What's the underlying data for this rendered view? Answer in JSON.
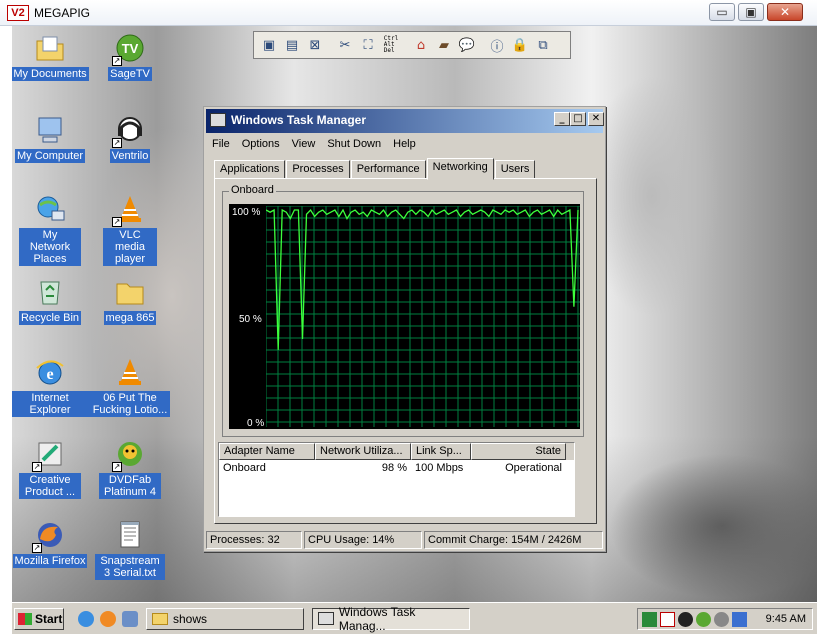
{
  "vnc": {
    "logo": "V2",
    "title": "MEGAPIG",
    "controls": [
      "▭",
      "▣",
      "✕"
    ],
    "toolbar_icons": [
      "new-connection-icon",
      "save-icon",
      "disconnect-icon",
      "options-icon",
      "fullscreen-icon",
      "ctrl-alt-del-icon",
      "transfer-icon",
      "folder-icon",
      "chat-icon",
      "info-icon",
      "lock-icon",
      "windows-icon"
    ],
    "ctrl_alt_del_text": "Ctrl\nAlt\nDel"
  },
  "desktop": {
    "icons_left": [
      {
        "name": "My Documents",
        "icon": "folder-docs-icon"
      },
      {
        "name": "My Computer",
        "icon": "computer-icon"
      },
      {
        "name": "My Network Places",
        "icon": "network-icon"
      },
      {
        "name": "Recycle Bin",
        "icon": "recycle-bin-icon"
      },
      {
        "name": "Internet Explorer",
        "icon": "ie-icon"
      },
      {
        "name": "Creative Product ...",
        "icon": "creative-icon"
      },
      {
        "name": "Mozilla Firefox",
        "icon": "firefox-icon"
      }
    ],
    "icons_right": [
      {
        "name": "SageTV",
        "icon": "sagetv-icon"
      },
      {
        "name": "Ventrilo",
        "icon": "ventrilo-icon"
      },
      {
        "name": "VLC media player",
        "icon": "vlc-icon"
      },
      {
        "name": "mega 865",
        "icon": "folder-icon"
      },
      {
        "name": "06 Put The Fucking Lotio...",
        "icon": "vlc-icon"
      },
      {
        "name": "DVDFab Platinum 4",
        "icon": "dvdfab-icon"
      },
      {
        "name": "Snapstream 3 Serial.txt",
        "icon": "text-file-icon"
      }
    ]
  },
  "task_manager": {
    "title": "Windows Task Manager",
    "menu": [
      "File",
      "Options",
      "View",
      "Shut Down",
      "Help"
    ],
    "tabs": [
      "Applications",
      "Processes",
      "Performance",
      "Networking",
      "Users"
    ],
    "active_tab": "Networking",
    "graph": {
      "title": "Onboard",
      "y_labels": [
        "100 %",
        "50 %",
        "0 %"
      ]
    },
    "adapters": {
      "columns": [
        "Adapter Name",
        "Network Utiliza...",
        "Link Sp...",
        "State"
      ],
      "rows": [
        {
          "name": "Onboard",
          "util": "98 %",
          "speed": "100 Mbps",
          "state": "Operational"
        }
      ]
    },
    "status": {
      "processes": "Processes: 32",
      "cpu": "CPU Usage: 14%",
      "commit": "Commit Charge: 154M / 2426M"
    }
  },
  "chart_data": {
    "type": "line",
    "title": "Onboard",
    "ylim": [
      0,
      100
    ],
    "yticks": [
      "100 %",
      "50 %",
      "0 %"
    ],
    "grid": true,
    "series": [
      {
        "values": [
          100,
          99,
          100,
          35,
          100,
          99,
          96,
          100,
          100,
          40,
          98,
          100,
          97,
          99,
          100,
          98,
          99,
          100,
          97,
          100,
          96,
          99,
          100,
          98,
          99,
          97,
          100,
          99,
          98,
          100,
          97,
          99,
          100,
          98,
          96,
          99,
          100,
          98,
          100,
          99,
          97,
          100,
          98,
          99,
          100,
          98,
          99,
          100,
          97,
          99,
          100,
          98,
          99,
          100,
          99,
          97,
          100,
          99,
          98,
          100,
          99,
          100,
          98,
          99,
          100,
          97,
          99,
          100,
          98,
          99,
          100,
          97,
          100,
          98,
          99,
          100,
          55,
          100
        ]
      }
    ]
  },
  "taskbar": {
    "start": "Start",
    "tasks": [
      {
        "label": "shows",
        "icon": "folder-icon",
        "active": false
      },
      {
        "label": "Windows Task Manag...",
        "icon": "task-manager-icon",
        "active": true
      }
    ],
    "clock": "9:45 AM"
  }
}
